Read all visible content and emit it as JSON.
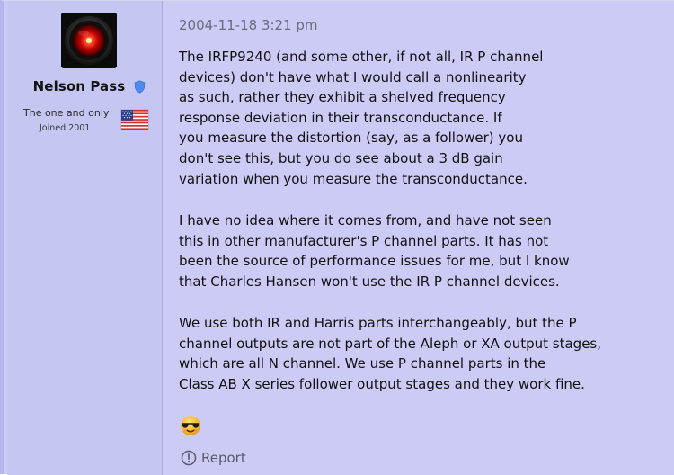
{
  "post": {
    "author": {
      "name": "Nelson Pass",
      "title": "The one and only",
      "joined": "Joined 2001",
      "badge_icon": "verified-shield-icon",
      "flag_icon": "us-flag-icon",
      "avatar_icon": "hal-9000-eye-avatar"
    },
    "timestamp": "2004-11-18 3:21 pm",
    "body": {
      "paragraph_1": "The IRFP9240 (and some other, if not all, IR P channel\ndevices) don't have what I would call a nonlinearity\nas such, rather they exhibit a shelved frequency\nresponse deviation in their transconductance. If\nyou measure the distortion (say, as a follower) you\ndon't see this, but you do see about a 3 dB gain\nvariation when you measure the transconductance.",
      "paragraph_2": "I have no idea where it comes from, and have not seen\nthis in other manufacturer's P channel parts. It has not\nbeen the source of performance issues for me, but I know\nthat Charles Hansen won't use the IR P channel devices.",
      "paragraph_3": "We use both IR and Harris parts interchangeably, but the P\nchannel outputs are not part of the Aleph or XA output stages,\nwhich are all N channel. We use P channel parts in the\nClass AB X series follower output stages and they work fine.",
      "emoji_icon": "cool-sunglasses-emoji"
    },
    "actions": {
      "report_label": "Report",
      "report_icon": "info-circle-icon"
    },
    "colors": {
      "sidebar_bg": "#c6c6f3",
      "content_bg": "#cbcbf6",
      "badge_blue": "#3f7fe3",
      "text_main": "#111111",
      "text_muted": "#6b6b80"
    }
  }
}
